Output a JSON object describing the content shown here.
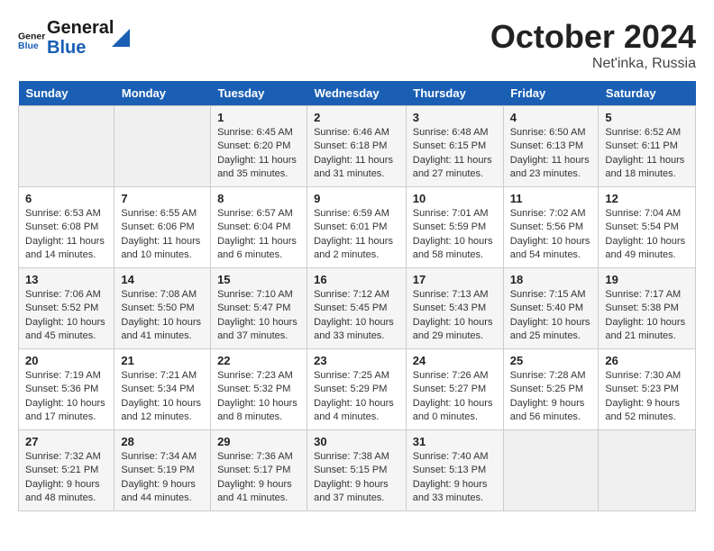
{
  "header": {
    "logo_general": "General",
    "logo_blue": "Blue",
    "month": "October 2024",
    "location": "Net'inka, Russia"
  },
  "columns": [
    "Sunday",
    "Monday",
    "Tuesday",
    "Wednesday",
    "Thursday",
    "Friday",
    "Saturday"
  ],
  "rows": [
    [
      {
        "day": "",
        "sunrise": "",
        "sunset": "",
        "daylight": ""
      },
      {
        "day": "",
        "sunrise": "",
        "sunset": "",
        "daylight": ""
      },
      {
        "day": "1",
        "sunrise": "Sunrise: 6:45 AM",
        "sunset": "Sunset: 6:20 PM",
        "daylight": "Daylight: 11 hours and 35 minutes."
      },
      {
        "day": "2",
        "sunrise": "Sunrise: 6:46 AM",
        "sunset": "Sunset: 6:18 PM",
        "daylight": "Daylight: 11 hours and 31 minutes."
      },
      {
        "day": "3",
        "sunrise": "Sunrise: 6:48 AM",
        "sunset": "Sunset: 6:15 PM",
        "daylight": "Daylight: 11 hours and 27 minutes."
      },
      {
        "day": "4",
        "sunrise": "Sunrise: 6:50 AM",
        "sunset": "Sunset: 6:13 PM",
        "daylight": "Daylight: 11 hours and 23 minutes."
      },
      {
        "day": "5",
        "sunrise": "Sunrise: 6:52 AM",
        "sunset": "Sunset: 6:11 PM",
        "daylight": "Daylight: 11 hours and 18 minutes."
      }
    ],
    [
      {
        "day": "6",
        "sunrise": "Sunrise: 6:53 AM",
        "sunset": "Sunset: 6:08 PM",
        "daylight": "Daylight: 11 hours and 14 minutes."
      },
      {
        "day": "7",
        "sunrise": "Sunrise: 6:55 AM",
        "sunset": "Sunset: 6:06 PM",
        "daylight": "Daylight: 11 hours and 10 minutes."
      },
      {
        "day": "8",
        "sunrise": "Sunrise: 6:57 AM",
        "sunset": "Sunset: 6:04 PM",
        "daylight": "Daylight: 11 hours and 6 minutes."
      },
      {
        "day": "9",
        "sunrise": "Sunrise: 6:59 AM",
        "sunset": "Sunset: 6:01 PM",
        "daylight": "Daylight: 11 hours and 2 minutes."
      },
      {
        "day": "10",
        "sunrise": "Sunrise: 7:01 AM",
        "sunset": "Sunset: 5:59 PM",
        "daylight": "Daylight: 10 hours and 58 minutes."
      },
      {
        "day": "11",
        "sunrise": "Sunrise: 7:02 AM",
        "sunset": "Sunset: 5:56 PM",
        "daylight": "Daylight: 10 hours and 54 minutes."
      },
      {
        "day": "12",
        "sunrise": "Sunrise: 7:04 AM",
        "sunset": "Sunset: 5:54 PM",
        "daylight": "Daylight: 10 hours and 49 minutes."
      }
    ],
    [
      {
        "day": "13",
        "sunrise": "Sunrise: 7:06 AM",
        "sunset": "Sunset: 5:52 PM",
        "daylight": "Daylight: 10 hours and 45 minutes."
      },
      {
        "day": "14",
        "sunrise": "Sunrise: 7:08 AM",
        "sunset": "Sunset: 5:50 PM",
        "daylight": "Daylight: 10 hours and 41 minutes."
      },
      {
        "day": "15",
        "sunrise": "Sunrise: 7:10 AM",
        "sunset": "Sunset: 5:47 PM",
        "daylight": "Daylight: 10 hours and 37 minutes."
      },
      {
        "day": "16",
        "sunrise": "Sunrise: 7:12 AM",
        "sunset": "Sunset: 5:45 PM",
        "daylight": "Daylight: 10 hours and 33 minutes."
      },
      {
        "day": "17",
        "sunrise": "Sunrise: 7:13 AM",
        "sunset": "Sunset: 5:43 PM",
        "daylight": "Daylight: 10 hours and 29 minutes."
      },
      {
        "day": "18",
        "sunrise": "Sunrise: 7:15 AM",
        "sunset": "Sunset: 5:40 PM",
        "daylight": "Daylight: 10 hours and 25 minutes."
      },
      {
        "day": "19",
        "sunrise": "Sunrise: 7:17 AM",
        "sunset": "Sunset: 5:38 PM",
        "daylight": "Daylight: 10 hours and 21 minutes."
      }
    ],
    [
      {
        "day": "20",
        "sunrise": "Sunrise: 7:19 AM",
        "sunset": "Sunset: 5:36 PM",
        "daylight": "Daylight: 10 hours and 17 minutes."
      },
      {
        "day": "21",
        "sunrise": "Sunrise: 7:21 AM",
        "sunset": "Sunset: 5:34 PM",
        "daylight": "Daylight: 10 hours and 12 minutes."
      },
      {
        "day": "22",
        "sunrise": "Sunrise: 7:23 AM",
        "sunset": "Sunset: 5:32 PM",
        "daylight": "Daylight: 10 hours and 8 minutes."
      },
      {
        "day": "23",
        "sunrise": "Sunrise: 7:25 AM",
        "sunset": "Sunset: 5:29 PM",
        "daylight": "Daylight: 10 hours and 4 minutes."
      },
      {
        "day": "24",
        "sunrise": "Sunrise: 7:26 AM",
        "sunset": "Sunset: 5:27 PM",
        "daylight": "Daylight: 10 hours and 0 minutes."
      },
      {
        "day": "25",
        "sunrise": "Sunrise: 7:28 AM",
        "sunset": "Sunset: 5:25 PM",
        "daylight": "Daylight: 9 hours and 56 minutes."
      },
      {
        "day": "26",
        "sunrise": "Sunrise: 7:30 AM",
        "sunset": "Sunset: 5:23 PM",
        "daylight": "Daylight: 9 hours and 52 minutes."
      }
    ],
    [
      {
        "day": "27",
        "sunrise": "Sunrise: 7:32 AM",
        "sunset": "Sunset: 5:21 PM",
        "daylight": "Daylight: 9 hours and 48 minutes."
      },
      {
        "day": "28",
        "sunrise": "Sunrise: 7:34 AM",
        "sunset": "Sunset: 5:19 PM",
        "daylight": "Daylight: 9 hours and 44 minutes."
      },
      {
        "day": "29",
        "sunrise": "Sunrise: 7:36 AM",
        "sunset": "Sunset: 5:17 PM",
        "daylight": "Daylight: 9 hours and 41 minutes."
      },
      {
        "day": "30",
        "sunrise": "Sunrise: 7:38 AM",
        "sunset": "Sunset: 5:15 PM",
        "daylight": "Daylight: 9 hours and 37 minutes."
      },
      {
        "day": "31",
        "sunrise": "Sunrise: 7:40 AM",
        "sunset": "Sunset: 5:13 PM",
        "daylight": "Daylight: 9 hours and 33 minutes."
      },
      {
        "day": "",
        "sunrise": "",
        "sunset": "",
        "daylight": ""
      },
      {
        "day": "",
        "sunrise": "",
        "sunset": "",
        "daylight": ""
      }
    ]
  ]
}
